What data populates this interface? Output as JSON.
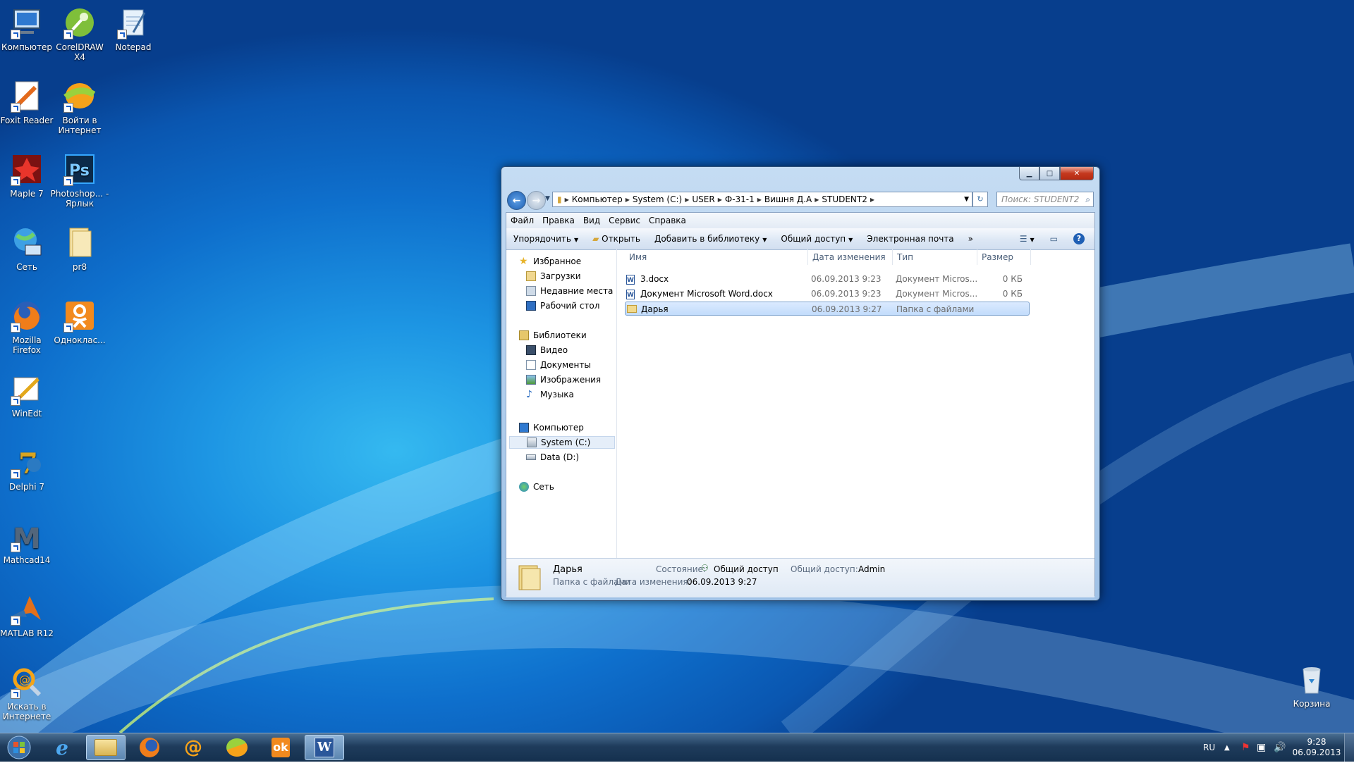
{
  "desktop": {
    "icons": [
      {
        "label": "Компьютер",
        "icon": "computer-icon"
      },
      {
        "label": "CorelDRAW X4",
        "icon": "coreldraw-icon"
      },
      {
        "label": "Notepad",
        "icon": "notepad-icon"
      },
      {
        "label": "Foxit Reader",
        "icon": "foxit-reader-icon"
      },
      {
        "label": "Войти в Интернет",
        "icon": "internet-login-icon"
      },
      {
        "label": "Maple 7",
        "icon": "maple-icon"
      },
      {
        "label": "Photoshop... - Ярлык",
        "icon": "photoshop-icon"
      },
      {
        "label": "Сеть",
        "icon": "network-icon"
      },
      {
        "label": "pr8",
        "icon": "folder-icon"
      },
      {
        "label": "Mozilla Firefox",
        "icon": "firefox-icon"
      },
      {
        "label": "Одноклас...",
        "icon": "odnoklassniki-icon"
      },
      {
        "label": "WinEdt",
        "icon": "winedt-icon"
      },
      {
        "label": "Delphi 7",
        "icon": "delphi-icon"
      },
      {
        "label": "Mathcad14",
        "icon": "mathcad-icon"
      },
      {
        "label": "MATLAB R12",
        "icon": "matlab-icon"
      },
      {
        "label": "Искать в Интернете",
        "icon": "web-search-icon"
      },
      {
        "label": "Корзина",
        "icon": "recycle-bin-icon"
      }
    ]
  },
  "explorer": {
    "nav": {
      "address": [
        "Компьютер",
        "System (C:)",
        "USER",
        "Ф-31-1",
        "Вишня Д.А",
        "STUDENT2"
      ],
      "search_placeholder": "Поиск: STUDENT2"
    },
    "menu": [
      "Файл",
      "Правка",
      "Вид",
      "Сервис",
      "Справка"
    ],
    "toolbar": {
      "organize": "Упорядочить",
      "open": "Открыть",
      "add_to_library": "Добавить в библиотеку",
      "share": "Общий доступ",
      "email": "Электронная почта",
      "more": "»"
    },
    "sidebar": {
      "favorites": "Избранное",
      "downloads": "Загрузки",
      "recent": "Недавние места",
      "desktop": "Рабочий стол",
      "libraries": "Библиотеки",
      "video": "Видео",
      "documents": "Документы",
      "images": "Изображения",
      "music": "Музыка",
      "computer": "Компьютер",
      "system_c": "System (C:)",
      "data_d": "Data (D:)",
      "network": "Сеть"
    },
    "columns": {
      "name": "Имя",
      "date": "Дата изменения",
      "type": "Тип",
      "size": "Размер"
    },
    "files": [
      {
        "name": "3.docx",
        "date": "06.09.2013 9:23",
        "type": "Документ Micros...",
        "size": "0 КБ",
        "icon": "word-doc-icon"
      },
      {
        "name": "Документ Microsoft Word.docx",
        "date": "06.09.2013 9:23",
        "type": "Документ Micros...",
        "size": "0 КБ",
        "icon": "word-doc-icon"
      },
      {
        "name": "Дарья",
        "date": "06.09.2013 9:27",
        "type": "Папка с файлами",
        "size": "",
        "icon": "folder-icon",
        "selected": true
      }
    ],
    "details": {
      "name": "Дарья",
      "kind": "Папка с файлами",
      "state_label": "Состояние:",
      "state_value": "Общий доступ",
      "shared_label": "Общий доступ:",
      "shared_value": "Admin",
      "modified_label": "Дата изменения:",
      "modified_value": "06.09.2013 9:27"
    }
  },
  "taskbar": {
    "tray": {
      "lang": "RU",
      "time": "9:28",
      "date": "06.09.2013"
    }
  }
}
